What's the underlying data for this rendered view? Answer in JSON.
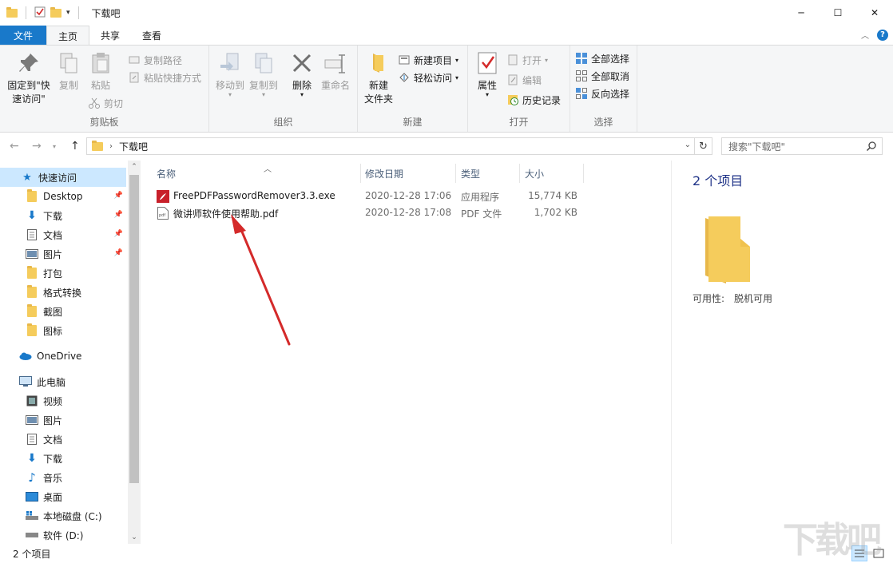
{
  "window": {
    "title": "下载吧",
    "minimize": "─",
    "maximize": "☐",
    "close": "✕"
  },
  "tabs": [
    {
      "label": "文件"
    },
    {
      "label": "主页"
    },
    {
      "label": "共享"
    },
    {
      "label": "查看"
    }
  ],
  "ribbon": {
    "clipboard": {
      "label": "剪贴板",
      "pin_line1": "固定到\"快",
      "pin_line2": "速访问\"",
      "copy": "复制",
      "paste": "粘贴",
      "copy_path": "复制路径",
      "paste_shortcut": "粘贴快捷方式",
      "cut": "剪切"
    },
    "organize": {
      "label": "组织",
      "move_to": "移动到",
      "copy_to": "复制到",
      "delete": "删除",
      "rename": "重命名"
    },
    "new": {
      "label": "新建",
      "new_folder_line1": "新建",
      "new_folder_line2": "文件夹",
      "new_item": "新建项目",
      "easy_access": "轻松访问"
    },
    "open": {
      "label": "打开",
      "properties": "属性",
      "open": "打开",
      "edit": "编辑",
      "history": "历史记录"
    },
    "select": {
      "label": "选择",
      "select_all": "全部选择",
      "select_none": "全部取消",
      "invert": "反向选择"
    }
  },
  "address": {
    "path": "下载吧",
    "search_placeholder": "搜索\"下载吧\""
  },
  "nav": {
    "quick_access": "快速访问",
    "items": [
      {
        "label": "Desktop",
        "pinned": true
      },
      {
        "label": "下载",
        "pinned": true
      },
      {
        "label": "文档",
        "pinned": true
      },
      {
        "label": "图片",
        "pinned": true
      },
      {
        "label": "打包"
      },
      {
        "label": "格式转换"
      },
      {
        "label": "截图"
      },
      {
        "label": "图标"
      }
    ],
    "onedrive": "OneDrive",
    "this_pc": "此电脑",
    "pc_items": [
      {
        "label": "视频"
      },
      {
        "label": "图片"
      },
      {
        "label": "文档"
      },
      {
        "label": "下载"
      },
      {
        "label": "音乐"
      },
      {
        "label": "桌面"
      },
      {
        "label": "本地磁盘 (C:)"
      },
      {
        "label": "软件 (D:)"
      }
    ]
  },
  "columns": {
    "name": "名称",
    "date": "修改日期",
    "type": "类型",
    "size": "大小"
  },
  "files": [
    {
      "name": "FreePDFPasswordRemover3.3.exe",
      "date": "2020-12-28 17:06",
      "type": "应用程序",
      "size": "15,774 KB"
    },
    {
      "name": "微讲师软件使用帮助.pdf",
      "date": "2020-12-28 17:08",
      "type": "PDF 文件",
      "size": "1,702 KB"
    }
  ],
  "preview": {
    "count": "2 个项目",
    "availability_label": "可用性:",
    "availability_value": "脱机可用"
  },
  "status": {
    "count": "2 个项目"
  },
  "colors": {
    "accent": "#1979ca",
    "selection": "#cce8ff",
    "arrow": "#d42a2a"
  }
}
